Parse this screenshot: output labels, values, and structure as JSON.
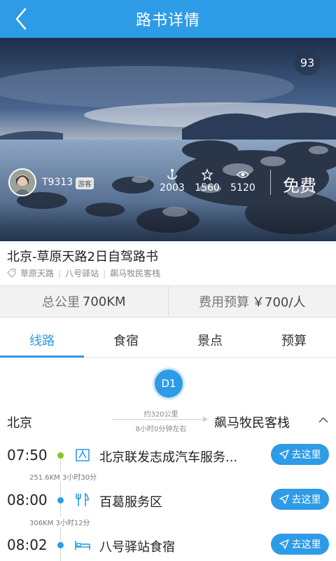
{
  "header": {
    "title": "路书详情"
  },
  "hero": {
    "score": "93",
    "author": "T9313",
    "author_badge": "游客",
    "stats": [
      {
        "icon": "anchor-icon",
        "value": "2003"
      },
      {
        "icon": "star-icon",
        "value": "1560"
      },
      {
        "icon": "eye-icon",
        "value": "5120"
      }
    ],
    "price": "免费"
  },
  "route": {
    "title": "北京-草原天路2日自驾路书",
    "tags": [
      "草原天路",
      "八号驿站",
      "飙马牧民客栈"
    ]
  },
  "summary": {
    "distance_label": "总公里",
    "distance_value": "700KM",
    "budget_label": "费用预算",
    "budget_value": "￥700/人"
  },
  "tabs": [
    "线路",
    "食宿",
    "景点",
    "预算"
  ],
  "day": {
    "badge": "D1",
    "from": "北京",
    "to": "飙马牧民客栈",
    "distance": "约320公里",
    "duration": "8小时0分钟左右"
  },
  "stops": [
    {
      "time": "07:50",
      "icon": "car-service-icon",
      "name": "北京联发志成汽车服务...",
      "dot_color": "#8dc21f",
      "button": "去这里"
    },
    {
      "time": "08:00",
      "icon": "restaurant-icon",
      "name": "百葛服务区",
      "dot_color": "#2e9be6",
      "button": "去这里"
    },
    {
      "time": "08:02",
      "icon": "bed-icon",
      "name": "八号驿站食宿",
      "dot_color": "#2e9be6",
      "button": "去这里"
    }
  ],
  "legs": [
    "251.6KM 3小时30分",
    "306KM 3小时12分"
  ]
}
